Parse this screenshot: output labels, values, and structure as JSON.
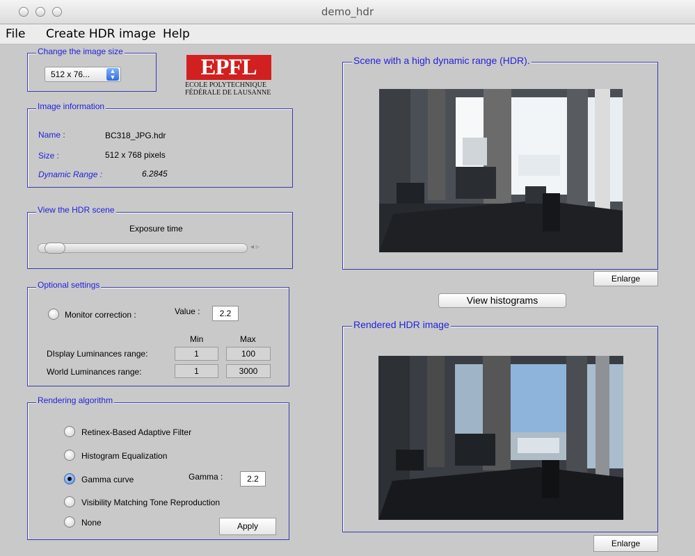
{
  "window": {
    "title": "demo_hdr"
  },
  "menu": {
    "items": [
      "File",
      "Create HDR image",
      "Help"
    ]
  },
  "image_size": {
    "legend": "Change the image size",
    "selected": "512 x 76..."
  },
  "logo": {
    "text": "EPFL",
    "line1": "ECOLE POLYTECHNIQUE",
    "line2": "FÉDÉRALE DE LAUSANNE"
  },
  "image_info": {
    "legend": "Image information",
    "name_label": "Name :",
    "name_value": "BC318_JPG.hdr",
    "size_label": "Size :",
    "size_value": "512 x 768 pixels",
    "range_label": "Dynamic Range :",
    "range_value": "6.2845"
  },
  "hdr_view": {
    "legend": "View the HDR scene",
    "exposure_label": "Exposure time",
    "slider_value": 0
  },
  "optional": {
    "legend": "Optional settings",
    "monitor_label": "Monitor correction :",
    "value_label": "Value :",
    "value": "2.2",
    "min_label": "Min",
    "max_label": "Max",
    "display_label": "DIsplay Luminances range:",
    "display_min": "1",
    "display_max": "100",
    "world_label": "World Luminances range:",
    "world_min": "1",
    "world_max": "3000"
  },
  "rendering": {
    "legend": "Rendering algorithm",
    "options": [
      "Retinex-Based Adaptive Filter",
      "Histogram Equalization",
      "Gamma curve",
      "Visibility Matching Tone Reproduction",
      "None"
    ],
    "selected_index": 2,
    "gamma_label": "Gamma :",
    "gamma_value": "2.2",
    "apply_label": "Apply"
  },
  "hdr_scene": {
    "legend": "Scene with a high dynamic range (HDR).",
    "enlarge_label": "Enlarge"
  },
  "histograms": {
    "label": "View  histograms"
  },
  "rendered": {
    "legend": "Rendered HDR image",
    "enlarge_label": "Enlarge"
  }
}
